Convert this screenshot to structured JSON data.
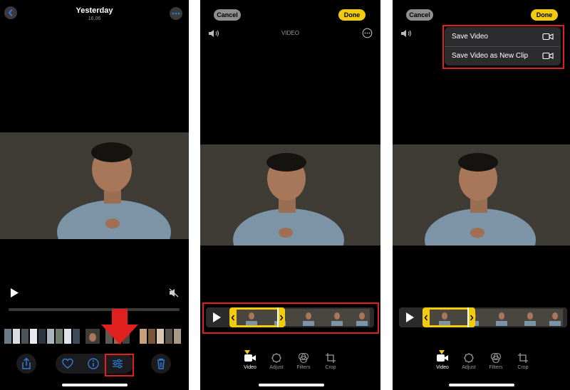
{
  "panel1": {
    "header": {
      "title": "Yesterday",
      "subtitle": "16.06"
    }
  },
  "panel2": {
    "cancel_label": "Cancel",
    "done_label": "Done",
    "mode_label": "VIDEO",
    "tools": [
      {
        "label": "Video",
        "icon": "video-camera-icon"
      },
      {
        "label": "Adjust",
        "icon": "adjust-dial-icon"
      },
      {
        "label": "Filters",
        "icon": "filters-icon"
      },
      {
        "label": "Crop",
        "icon": "crop-icon"
      }
    ]
  },
  "panel3": {
    "cancel_label": "Cancel",
    "done_label": "Done",
    "menu": [
      {
        "label": "Save Video",
        "icon": "video-camera-icon"
      },
      {
        "label": "Save Video as New Clip",
        "icon": "video-camera-icon"
      }
    ],
    "tools": [
      {
        "label": "Video",
        "icon": "video-camera-icon"
      },
      {
        "label": "Adjust",
        "icon": "adjust-dial-icon"
      },
      {
        "label": "Filters",
        "icon": "filters-icon"
      },
      {
        "label": "Crop",
        "icon": "crop-icon"
      }
    ]
  },
  "colors": {
    "accent_yellow": "#f2cc0c",
    "ios_blue": "#2f7ddb",
    "highlight_red": "#e0201f"
  }
}
